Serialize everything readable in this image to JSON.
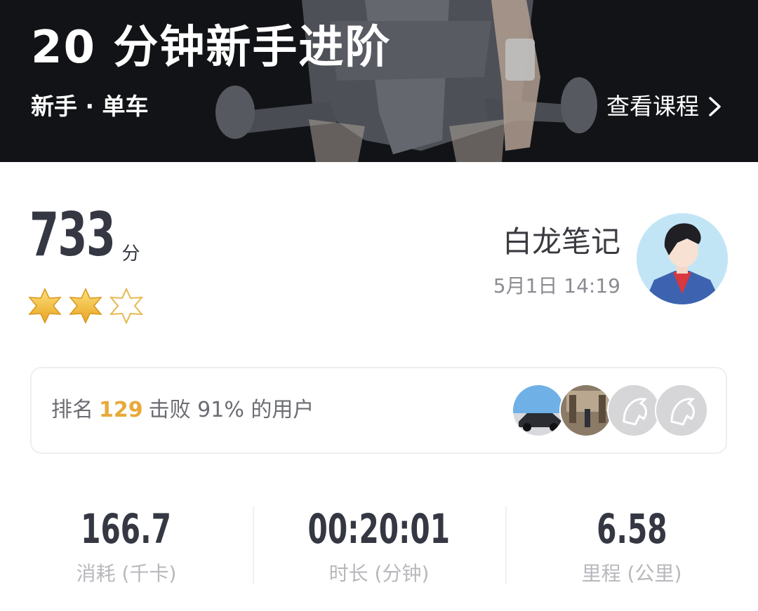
{
  "hero": {
    "title": "20 分钟新手进阶",
    "subtitle": "新手 · 单车",
    "link_label": "查看课程"
  },
  "score": {
    "value": "733",
    "unit": "分",
    "stars_filled": 2,
    "stars_total": 3
  },
  "user": {
    "name": "白龙笔记",
    "time": "5月1日 14:19"
  },
  "rank": {
    "prefix": "排名",
    "number": "129",
    "suffix": "击败 91% 的用户"
  },
  "stats": [
    {
      "value": "166.7",
      "label": "消耗 (千卡)"
    },
    {
      "value": "00:20:01",
      "label": "时长 (分钟)"
    },
    {
      "value": "6.58",
      "label": "里程 (公里)"
    }
  ],
  "colors": {
    "hero_bg": "#17181c",
    "accent": "#e8a93b",
    "text_dark": "#353842",
    "text_muted": "#b7b8bc",
    "star_gold": "#f5c342"
  }
}
